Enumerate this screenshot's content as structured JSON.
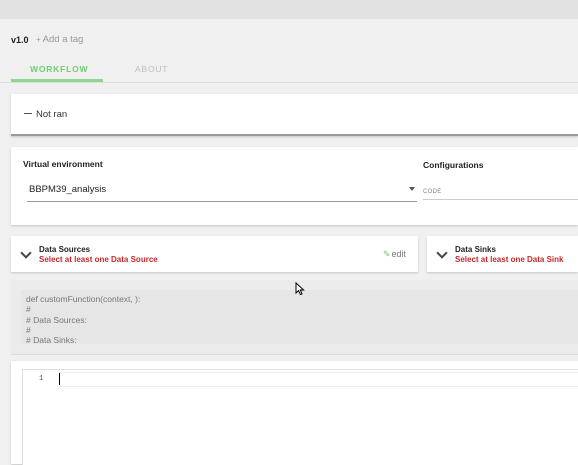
{
  "header": {
    "version": "v1.0",
    "add_tag": "Add a tag"
  },
  "tabs": [
    {
      "label": "WORKFLOW",
      "active": true
    },
    {
      "label": "ABOUT",
      "active": false
    }
  ],
  "status": {
    "text": "Not ran"
  },
  "environment": {
    "label": "Virtual environment",
    "value": "BBPM39_analysis"
  },
  "configurations": {
    "label": "Configurations",
    "code_placeholder": "CODE"
  },
  "data_sources": {
    "title": "Data Sources",
    "subtitle": "Select at least one Data Source",
    "edit_label": "edit"
  },
  "data_sinks": {
    "title": "Data Sinks",
    "subtitle": "Select at least one Data Sink"
  },
  "code_preview": {
    "lines": [
      "def customFunction(context, ):",
      "#",
      "# Data Sources:",
      "#",
      "# Data Sinks:"
    ]
  },
  "editor": {
    "line_number": "1"
  },
  "colors": {
    "accent": "#6fcf6f",
    "error": "#c62828",
    "background": "#f0f0f0"
  }
}
